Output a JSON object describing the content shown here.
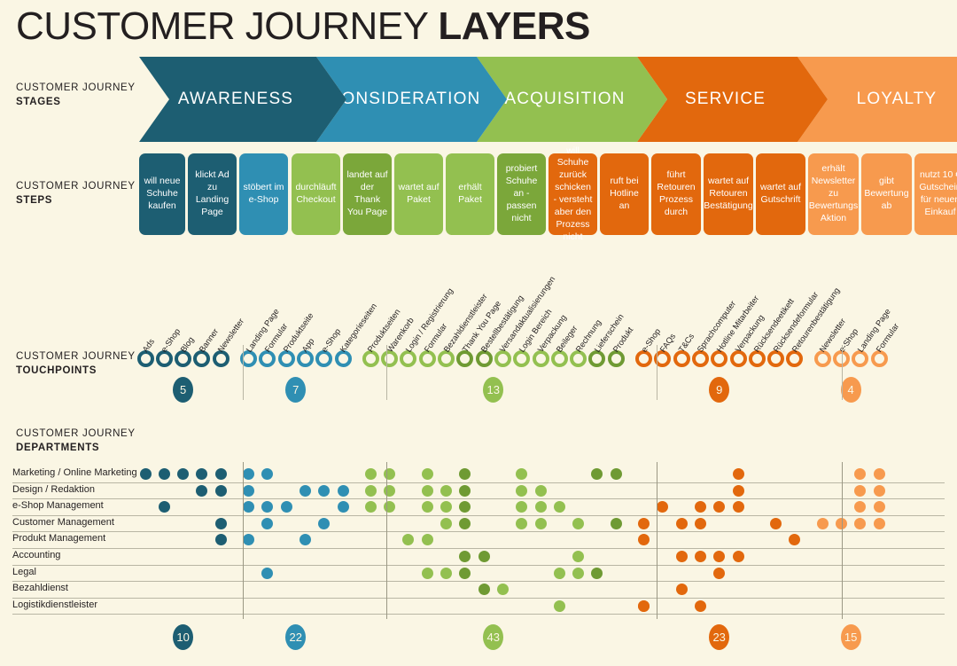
{
  "title": {
    "light": "CUSTOMER JOURNEY ",
    "bold": "LAYERS"
  },
  "colors": {
    "background": "#faf6e4",
    "awareness": "#1d5e72",
    "consideration": "#2f8fb3",
    "acquisition": "#93c050",
    "acquisition_dark": "#6f9a33",
    "service": "#e2680d",
    "loyalty": "#f59council",
    "loyalty_real": "#f79a4e",
    "rule": "#b9b6a4"
  },
  "row_labels": {
    "stages": {
      "line1": "CUSTOMER JOURNEY",
      "line2": "STAGES"
    },
    "steps": {
      "line1": "CUSTOMER JOURNEY",
      "line2": "STEPS"
    },
    "touchpoints": {
      "line1": "CUSTOMER JOURNEY",
      "line2": "TOUCHPOINTS"
    },
    "departments": {
      "line1": "CUSTOMER JOURNEY",
      "line2": "DEPARTMENTS"
    }
  },
  "stages": [
    {
      "label": "AWARENESS",
      "color": "#1d5e72"
    },
    {
      "label": "CONSIDERATION",
      "color": "#2f8fb3"
    },
    {
      "label": "ACQUISITION",
      "color": "#93c050"
    },
    {
      "label": "SERVICE",
      "color": "#e2680d"
    },
    {
      "label": "LOYALTY",
      "color": "#f79a4e"
    }
  ],
  "steps": [
    {
      "text": "will neue Schuhe kaufen",
      "color": "#1d5e72"
    },
    {
      "text": "klickt Ad zu Landing Page",
      "color": "#1d5e72"
    },
    {
      "text": "stöbert im e-Shop",
      "color": "#2f8fb3"
    },
    {
      "text": "durchläuft Checkout",
      "color": "#93c050"
    },
    {
      "text": "landet auf der Thank You Page",
      "color": "#7ba73a"
    },
    {
      "text": "wartet auf Paket",
      "color": "#93c050"
    },
    {
      "text": "erhält Paket",
      "color": "#93c050"
    },
    {
      "text": "probiert Schuhe an - passen nicht",
      "color": "#7ba73a"
    },
    {
      "text": "will Schuhe zurück schicken - versteht aber den Prozess nicht",
      "color": "#e2680d"
    },
    {
      "text": "ruft bei Hotline an",
      "color": "#e2680d"
    },
    {
      "text": "führt Retouren Prozess durch",
      "color": "#e2680d"
    },
    {
      "text": "wartet auf Retouren Bestätigung",
      "color": "#e2680d"
    },
    {
      "text": "wartet auf Gutschrift",
      "color": "#e2680d"
    },
    {
      "text": "erhält Newsletter zu Bewertungs Aktion",
      "color": "#f79a4e"
    },
    {
      "text": "gibt Bewertung ab",
      "color": "#f79a4e"
    },
    {
      "text": "nutzt 10 € Gutschein für neuen Einkauf",
      "color": "#f79a4e"
    }
  ],
  "touchpoint_groups": [
    {
      "stage": "AWARENESS",
      "color": "#1d5e72",
      "badge": "5",
      "items": [
        "Ads",
        "e-Shop",
        "Blog",
        "Banner",
        "Newsletter"
      ]
    },
    {
      "stage": "CONSIDERATION",
      "color": "#2f8fb3",
      "badge": "7",
      "items": [
        "Landing Page",
        "Formular",
        "Produktseite",
        "App",
        "e-Shop",
        "Kategorieseiten"
      ]
    },
    {
      "stage": "ACQUISITION",
      "color": "#93c050",
      "badge": "13",
      "items": [
        "Produktseiten",
        "Warenkorb",
        "Login / Registrierung",
        "Formular",
        "Bezahldienstleister",
        "Thank You Page",
        "Bestellbestätigung",
        "Versandaktualisierungen",
        "Login Bereich",
        "Verpackung",
        "Beileger",
        "Rechnung",
        "Lieferschein",
        "Produkt"
      ]
    },
    {
      "stage": "SERVICE",
      "color": "#e2680d",
      "badge": "9",
      "items": [
        "e-Shop",
        "FAQs",
        "T&Cs",
        "Sprachcomputer",
        "Hotline Mitarbeiter",
        "Verpackung",
        "Rücksendeetikett",
        "Rücksendeformular",
        "Retourenbestätigung"
      ]
    },
    {
      "stage": "LOYALTY",
      "color": "#f79a4e",
      "badge": "4",
      "items": [
        "Newsletter",
        "e-Shop",
        "Landing Page",
        "Formular"
      ]
    }
  ],
  "departments": [
    "Marketing / Online Marketing",
    "Design / Redaktion",
    "e-Shop Management",
    "Customer Management",
    "Produkt Management",
    "Accounting",
    "Legal",
    "Bezahldienst",
    "Logistikdienstleister"
  ],
  "department_badges": [
    "10",
    "22",
    "43",
    "23",
    "15"
  ],
  "department_matrix": [
    {
      "row": 0,
      "cols": [
        0,
        1,
        2,
        3,
        4,
        5,
        6,
        11,
        12,
        14,
        16,
        19,
        23,
        24,
        30,
        36,
        37,
        38
      ]
    },
    {
      "row": 1,
      "cols": [
        3,
        4,
        5,
        8,
        9,
        10,
        11,
        12,
        14,
        15,
        16,
        19,
        20,
        30,
        36,
        37,
        38
      ]
    },
    {
      "row": 2,
      "cols": [
        1,
        5,
        6,
        7,
        10,
        11,
        12,
        14,
        15,
        16,
        19,
        20,
        21,
        26,
        28,
        29,
        30,
        36,
        37,
        38
      ]
    },
    {
      "row": 3,
      "cols": [
        4,
        6,
        9,
        15,
        16,
        19,
        20,
        22,
        24,
        25,
        27,
        28,
        32,
        34,
        35,
        36,
        37,
        38
      ]
    },
    {
      "row": 4,
      "cols": [
        4,
        5,
        8,
        13,
        14,
        25,
        33
      ]
    },
    {
      "row": 5,
      "cols": [
        16,
        17,
        22,
        27,
        28,
        29,
        30
      ]
    },
    {
      "row": 6,
      "cols": [
        6,
        14,
        15,
        16,
        23,
        21,
        22,
        29,
        39
      ]
    },
    {
      "row": 7,
      "cols": [
        17,
        18,
        27
      ]
    },
    {
      "row": 8,
      "cols": [
        21,
        25,
        28,
        25
      ]
    }
  ]
}
